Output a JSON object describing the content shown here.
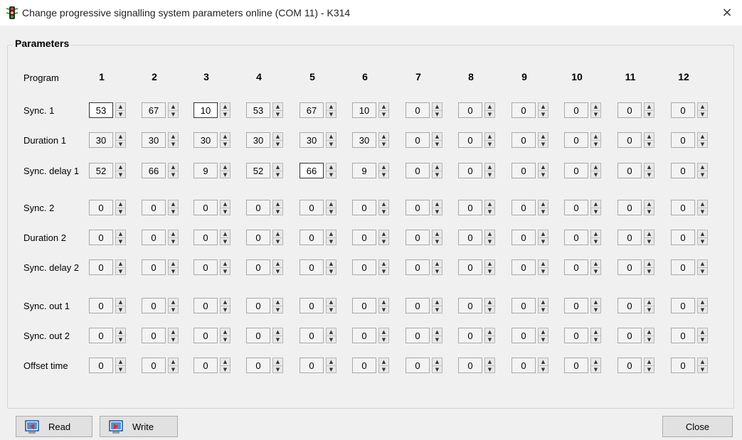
{
  "window": {
    "title": "Change progressive signalling system parameters online (COM 11) - K314",
    "close_glyph": "×",
    "icon": "traffic-light-icon"
  },
  "group": {
    "label": "Parameters"
  },
  "program_label": "Program",
  "programs": [
    "1",
    "2",
    "3",
    "4",
    "5",
    "6",
    "7",
    "8",
    "9",
    "10",
    "11",
    "12"
  ],
  "rows": [
    {
      "label": "Sync. 1",
      "values": [
        "53",
        "67",
        "10",
        "53",
        "67",
        "10",
        "0",
        "0",
        "0",
        "0",
        "0",
        "0"
      ]
    },
    {
      "label": "Duration 1",
      "values": [
        "30",
        "30",
        "30",
        "30",
        "30",
        "30",
        "0",
        "0",
        "0",
        "0",
        "0",
        "0"
      ]
    },
    {
      "label": "Sync. delay 1",
      "values": [
        "52",
        "66",
        "9",
        "52",
        "66",
        "9",
        "0",
        "0",
        "0",
        "0",
        "0",
        "0"
      ]
    },
    {
      "label": "Sync. 2",
      "values": [
        "0",
        "0",
        "0",
        "0",
        "0",
        "0",
        "0",
        "0",
        "0",
        "0",
        "0",
        "0"
      ]
    },
    {
      "label": "Duration 2",
      "values": [
        "0",
        "0",
        "0",
        "0",
        "0",
        "0",
        "0",
        "0",
        "0",
        "0",
        "0",
        "0"
      ]
    },
    {
      "label": "Sync. delay 2",
      "values": [
        "0",
        "0",
        "0",
        "0",
        "0",
        "0",
        "0",
        "0",
        "0",
        "0",
        "0",
        "0"
      ]
    },
    {
      "label": "Sync. out 1",
      "values": [
        "0",
        "0",
        "0",
        "0",
        "0",
        "0",
        "0",
        "0",
        "0",
        "0",
        "0",
        "0"
      ]
    },
    {
      "label": "Sync. out 2",
      "values": [
        "0",
        "0",
        "0",
        "0",
        "0",
        "0",
        "0",
        "0",
        "0",
        "0",
        "0",
        "0"
      ]
    },
    {
      "label": "Offset time",
      "values": [
        "0",
        "0",
        "0",
        "0",
        "0",
        "0",
        "0",
        "0",
        "0",
        "0",
        "0",
        "0"
      ]
    }
  ],
  "buttons": {
    "read": "Read",
    "write": "Write",
    "close": "Close"
  },
  "spin_glyphs": {
    "up": "▲",
    "down": "▼"
  }
}
